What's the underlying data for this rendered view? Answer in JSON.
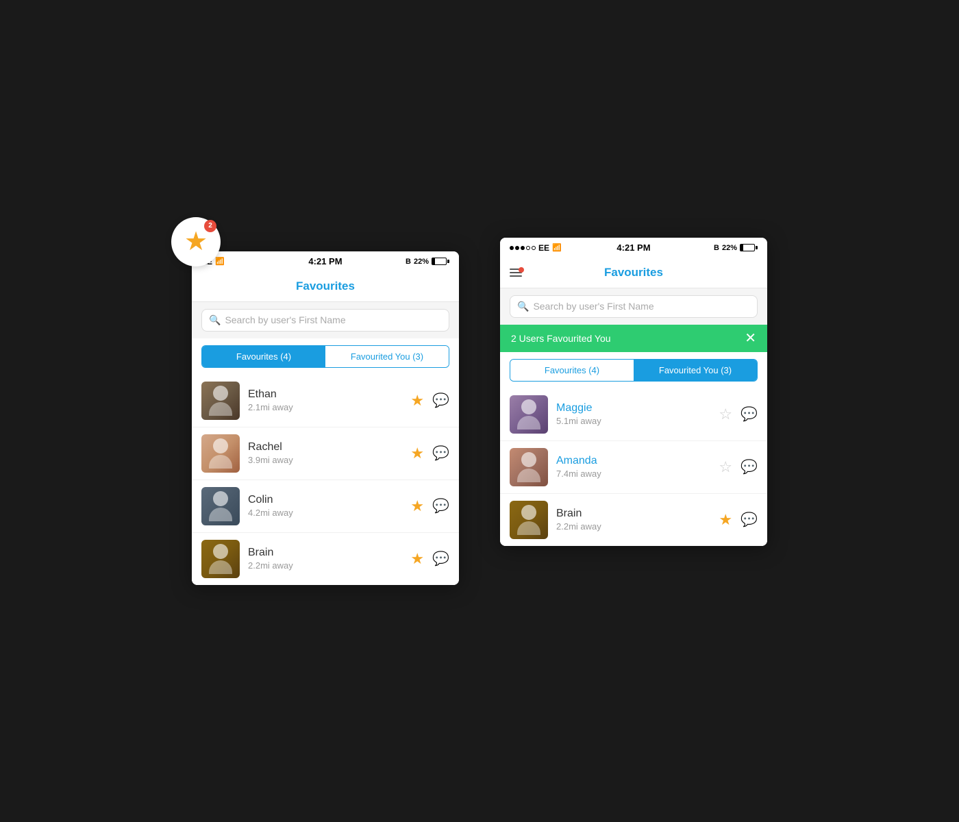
{
  "scene": {
    "background": "#1a1a1a"
  },
  "phone_left": {
    "status_bar": {
      "carrier": "EE",
      "time": "4:21 PM",
      "battery": "22%",
      "has_wifi": true,
      "has_bt": true
    },
    "nav": {
      "title": "Favourites"
    },
    "search": {
      "placeholder": "Search by user's First Name"
    },
    "tabs": {
      "active": "Favourites (4)",
      "inactive": "Favourited You (3)"
    },
    "users": [
      {
        "name": "Ethan",
        "distance": "2.1mi away",
        "starred": true,
        "avatar_class": "avatar-ethan"
      },
      {
        "name": "Rachel",
        "distance": "3.9mi away",
        "starred": true,
        "avatar_class": "avatar-rachel"
      },
      {
        "name": "Colin",
        "distance": "4.2mi away",
        "starred": true,
        "avatar_class": "avatar-colin"
      },
      {
        "name": "Brain",
        "distance": "2.2mi away",
        "starred": true,
        "avatar_class": "avatar-brain"
      }
    ],
    "star_badge": {
      "count": "2",
      "label": "★"
    }
  },
  "phone_right": {
    "status_bar": {
      "carrier": "EE",
      "time": "4:21 PM",
      "battery": "22%",
      "has_wifi": true,
      "has_bt": true
    },
    "nav": {
      "title": "Favourites"
    },
    "search": {
      "placeholder": "Search by user's First Name"
    },
    "notification_banner": {
      "text": "2 Users Favourited You",
      "close_label": "✕"
    },
    "tabs": {
      "active": "Favourited You (3)",
      "inactive": "Favourites (4)"
    },
    "users": [
      {
        "name": "Maggie",
        "distance": "5.1mi away",
        "starred": false,
        "name_color": "blue",
        "avatar_class": "avatar-maggie"
      },
      {
        "name": "Amanda",
        "distance": "7.4mi away",
        "starred": false,
        "name_color": "blue",
        "avatar_class": "avatar-amanda"
      },
      {
        "name": "Brain",
        "distance": "2.2mi away",
        "starred": true,
        "name_color": "normal",
        "avatar_class": "avatar-brain2"
      }
    ],
    "hamburger": {
      "has_notification": true
    }
  }
}
